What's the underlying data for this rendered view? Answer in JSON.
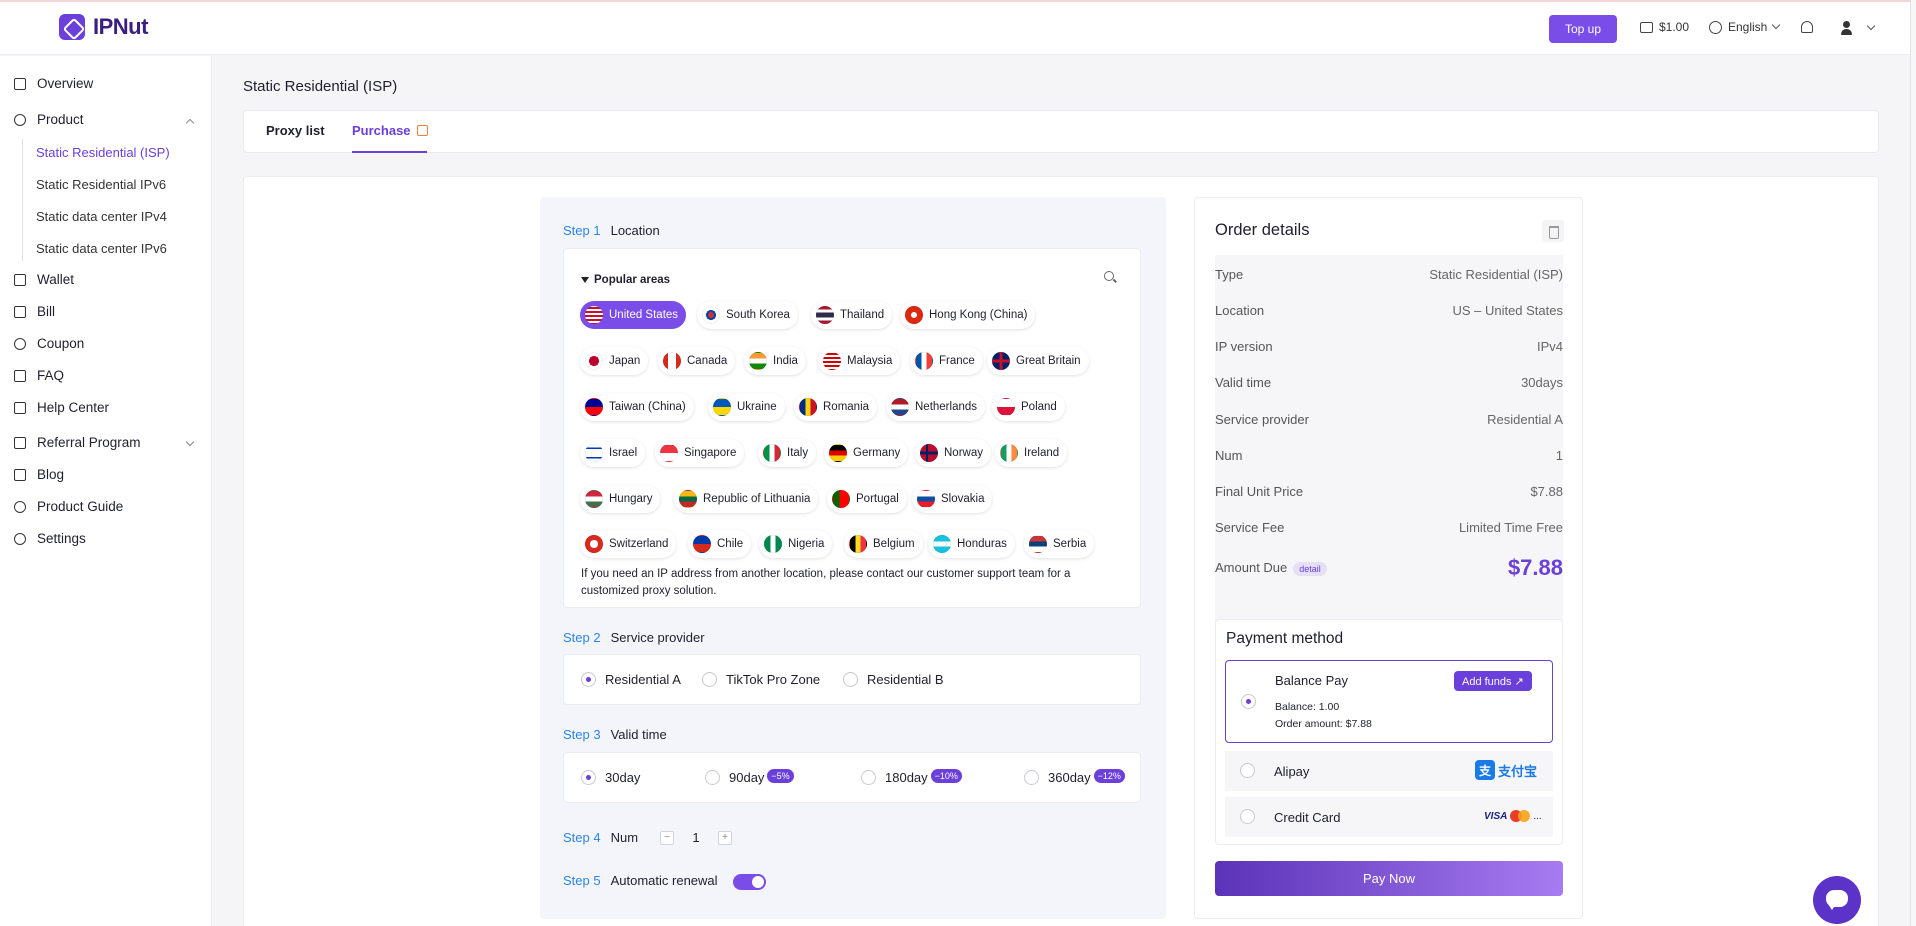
{
  "header": {
    "logo_text": "IPNut",
    "topup_label": "Top up",
    "balance": "$1.00",
    "language": "English"
  },
  "sidebar": {
    "items": [
      {
        "label": "Overview",
        "icon": "overview-icon"
      },
      {
        "label": "Product",
        "icon": "product-icon"
      },
      {
        "label": "Wallet",
        "icon": "wallet-icon"
      },
      {
        "label": "Bill",
        "icon": "bill-icon"
      },
      {
        "label": "Coupon",
        "icon": "coupon-icon"
      },
      {
        "label": "FAQ",
        "icon": "faq-icon"
      },
      {
        "label": "Help Center",
        "icon": "help-icon"
      },
      {
        "label": "Referral Program",
        "icon": "referral-icon"
      },
      {
        "label": "Blog",
        "icon": "blog-icon"
      },
      {
        "label": "Product Guide",
        "icon": "compass-icon"
      },
      {
        "label": "Settings",
        "icon": "gear-icon"
      }
    ],
    "product_sub": [
      "Static Residential (ISP)",
      "Static Residential IPv6",
      "Static data center IPv4",
      "Static data center IPv6"
    ]
  },
  "page": {
    "title": "Static Residential (ISP)",
    "tabs": [
      "Proxy list",
      "Purchase"
    ]
  },
  "steps": {
    "s1_num": "Step 1",
    "s1_label": "Location",
    "s2_num": "Step 2",
    "s2_label": "Service provider",
    "s3_num": "Step 3",
    "s3_label": "Valid time",
    "s4_num": "Step 4",
    "s4_label": "Num",
    "s5_num": "Step 5",
    "s5_label": "Automatic renewal"
  },
  "location": {
    "popular_label": "Popular areas",
    "selected": "United States",
    "countries": [
      "United States",
      "South Korea",
      "Thailand",
      "Hong Kong (China)",
      "Japan",
      "Canada",
      "India",
      "Malaysia",
      "France",
      "Great Britain",
      "Taiwan (China)",
      "Ukraine",
      "Romania",
      "Netherlands",
      "Poland",
      "Israel",
      "Singapore",
      "Italy",
      "Germany",
      "Norway",
      "Ireland",
      "Hungary",
      "Republic of Lithuania",
      "Portugal",
      "Slovakia",
      "Switzerland",
      "Chile",
      "Nigeria",
      "Belgium",
      "Honduras",
      "Serbia"
    ],
    "note": "If you need an IP address from another location, please contact our customer support team for a customized proxy solution."
  },
  "providers": [
    "Residential A",
    "TikTok Pro Zone",
    "Residential B"
  ],
  "valid_time": [
    {
      "label": "30day",
      "discount": ""
    },
    {
      "label": "90day",
      "discount": "−5%"
    },
    {
      "label": "180day",
      "discount": "−10%"
    },
    {
      "label": "360day",
      "discount": "−12%"
    }
  ],
  "num": {
    "value": "1",
    "minus": "−",
    "plus": "+"
  },
  "order": {
    "title": "Order details",
    "rows": [
      {
        "k": "Type",
        "v": "Static Residential (ISP)"
      },
      {
        "k": "Location",
        "v": "US – United States"
      },
      {
        "k": "IP version",
        "v": "IPv4"
      },
      {
        "k": "Valid time",
        "v": "30days"
      },
      {
        "k": "Service provider",
        "v": "Residential A"
      },
      {
        "k": "Num",
        "v": "1"
      },
      {
        "k": "Final Unit Price",
        "v": "$7.88"
      },
      {
        "k": "Service Fee",
        "v": "Limited Time Free"
      }
    ],
    "amount_label": "Amount Due",
    "detail_badge": "detail",
    "amount": "$7.88"
  },
  "payment": {
    "title": "Payment method",
    "balance_pay": "Balance Pay",
    "add_funds": "Add funds ↗",
    "balance_line": "Balance: 1.00",
    "order_amount_line": "Order amount: $7.88",
    "alipay": "Alipay",
    "alipay_brand": "支付宝",
    "credit_card": "Credit Card",
    "card_brand": "VISA",
    "card_more": "...",
    "pay_now": "Pay Now"
  },
  "colors": {
    "accent": "#6b3fd9",
    "step_blue": "#2a85e8",
    "amount": "#6b3fd9"
  }
}
